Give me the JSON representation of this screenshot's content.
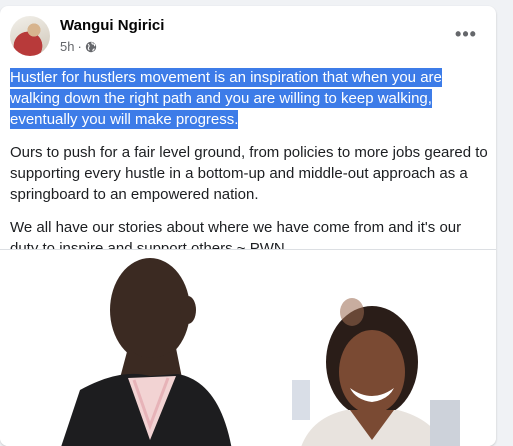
{
  "post": {
    "author": "Wangui Ngirici",
    "time": "5h",
    "privacy_sep": "·",
    "menu_glyph": "•••",
    "highlighted_text": "Hustler for hustlers movement is an inspiration that when you are walking down the right  path and you are willing to keep walking, eventually you will make progress.",
    "paragraph_2": "Ours to push for a fair level ground, from policies to more jobs geared to supporting every hustle in a bottom-up and middle-out approach as a springboard to an empowered nation.",
    "paragraph_3": "We all have our stories about where we have come from and it's our duty to inspire and support others ~ PWN."
  },
  "icons": {
    "privacy": "globe-icon",
    "menu": "more-options-icon"
  },
  "colors": {
    "selection_highlight": "#3d7ce8",
    "page_bg": "#f0f2f5",
    "card_bg": "#ffffff",
    "meta_text": "#65676b"
  }
}
